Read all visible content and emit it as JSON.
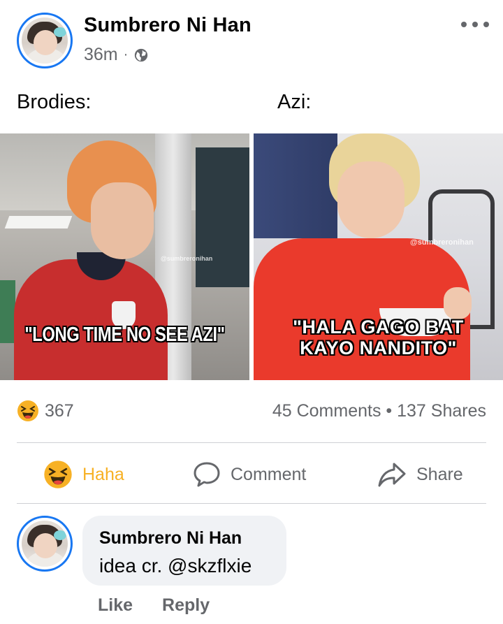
{
  "post": {
    "author": "Sumbrero Ni Han",
    "time": "36m",
    "separator": "·",
    "privacy_icon": "globe-icon",
    "more_icon": "more-horizontal-icon",
    "caption_left": "Brodies:",
    "caption_right": "Azi:",
    "image_left_text": "\"LONG TIME NO SEE AZI\"",
    "image_left_watermark": "@sumbreronihan",
    "image_right_text_line1": "\"HALA GAGO BAT",
    "image_right_text_line2": "KAYO NANDITO\"",
    "image_right_watermark": "@sumbreronihan"
  },
  "stats": {
    "reaction_icon": "haha-emoji-icon",
    "reaction_count": "367",
    "comments": "45 Comments",
    "dot": "•",
    "shares": "137 Shares"
  },
  "actions": {
    "haha_label": "Haha",
    "comment_label": "Comment",
    "share_label": "Share"
  },
  "comment": {
    "author": "Sumbrero Ni Han",
    "text": "idea cr. @skzflxie",
    "like_label": "Like",
    "reply_label": "Reply"
  },
  "colors": {
    "accent": "#1877f2",
    "haha": "#f7b125",
    "muted": "#65676b",
    "bubble": "#f0f2f5"
  }
}
